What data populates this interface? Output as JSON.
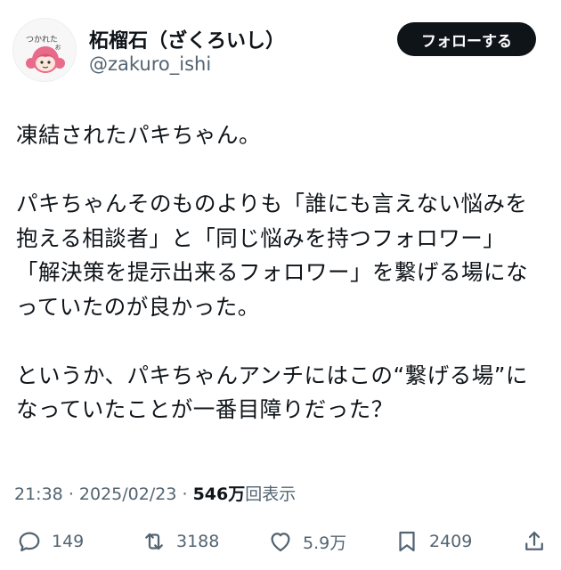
{
  "user": {
    "display_name": "柘榴石（ざくろいし）",
    "handle": "@zakuro_ishi",
    "avatar_caption": "つかれたぉ"
  },
  "follow_button": {
    "label": "フォローする"
  },
  "tweet": {
    "lines": [
      "凍結されたパキちゃん。",
      "",
      "パキちゃんそのものよりも「誰にも言えない悩みを",
      "抱える相談者」と「同じ悩みを持つフォロワー」",
      "「解決策を提示出来るフォロワー」を繋げる場にな",
      "っていたのが良かった。",
      "",
      "というか、パキちゃんアンチにはこの“繋げる場”に",
      "なっていたことが一番目障りだった？"
    ]
  },
  "meta": {
    "time": "21:38",
    "separator": "·",
    "date": "2025/02/23",
    "views_count": "546万",
    "views_label": "回表示"
  },
  "actions": {
    "reply_count": "149",
    "repost_count": "3188",
    "like_count": "5.9万",
    "bookmark_count": "2409"
  },
  "icons": {
    "reply": "reply-icon",
    "repost": "repost-icon",
    "like": "heart-icon",
    "bookmark": "bookmark-icon",
    "share": "share-icon"
  }
}
